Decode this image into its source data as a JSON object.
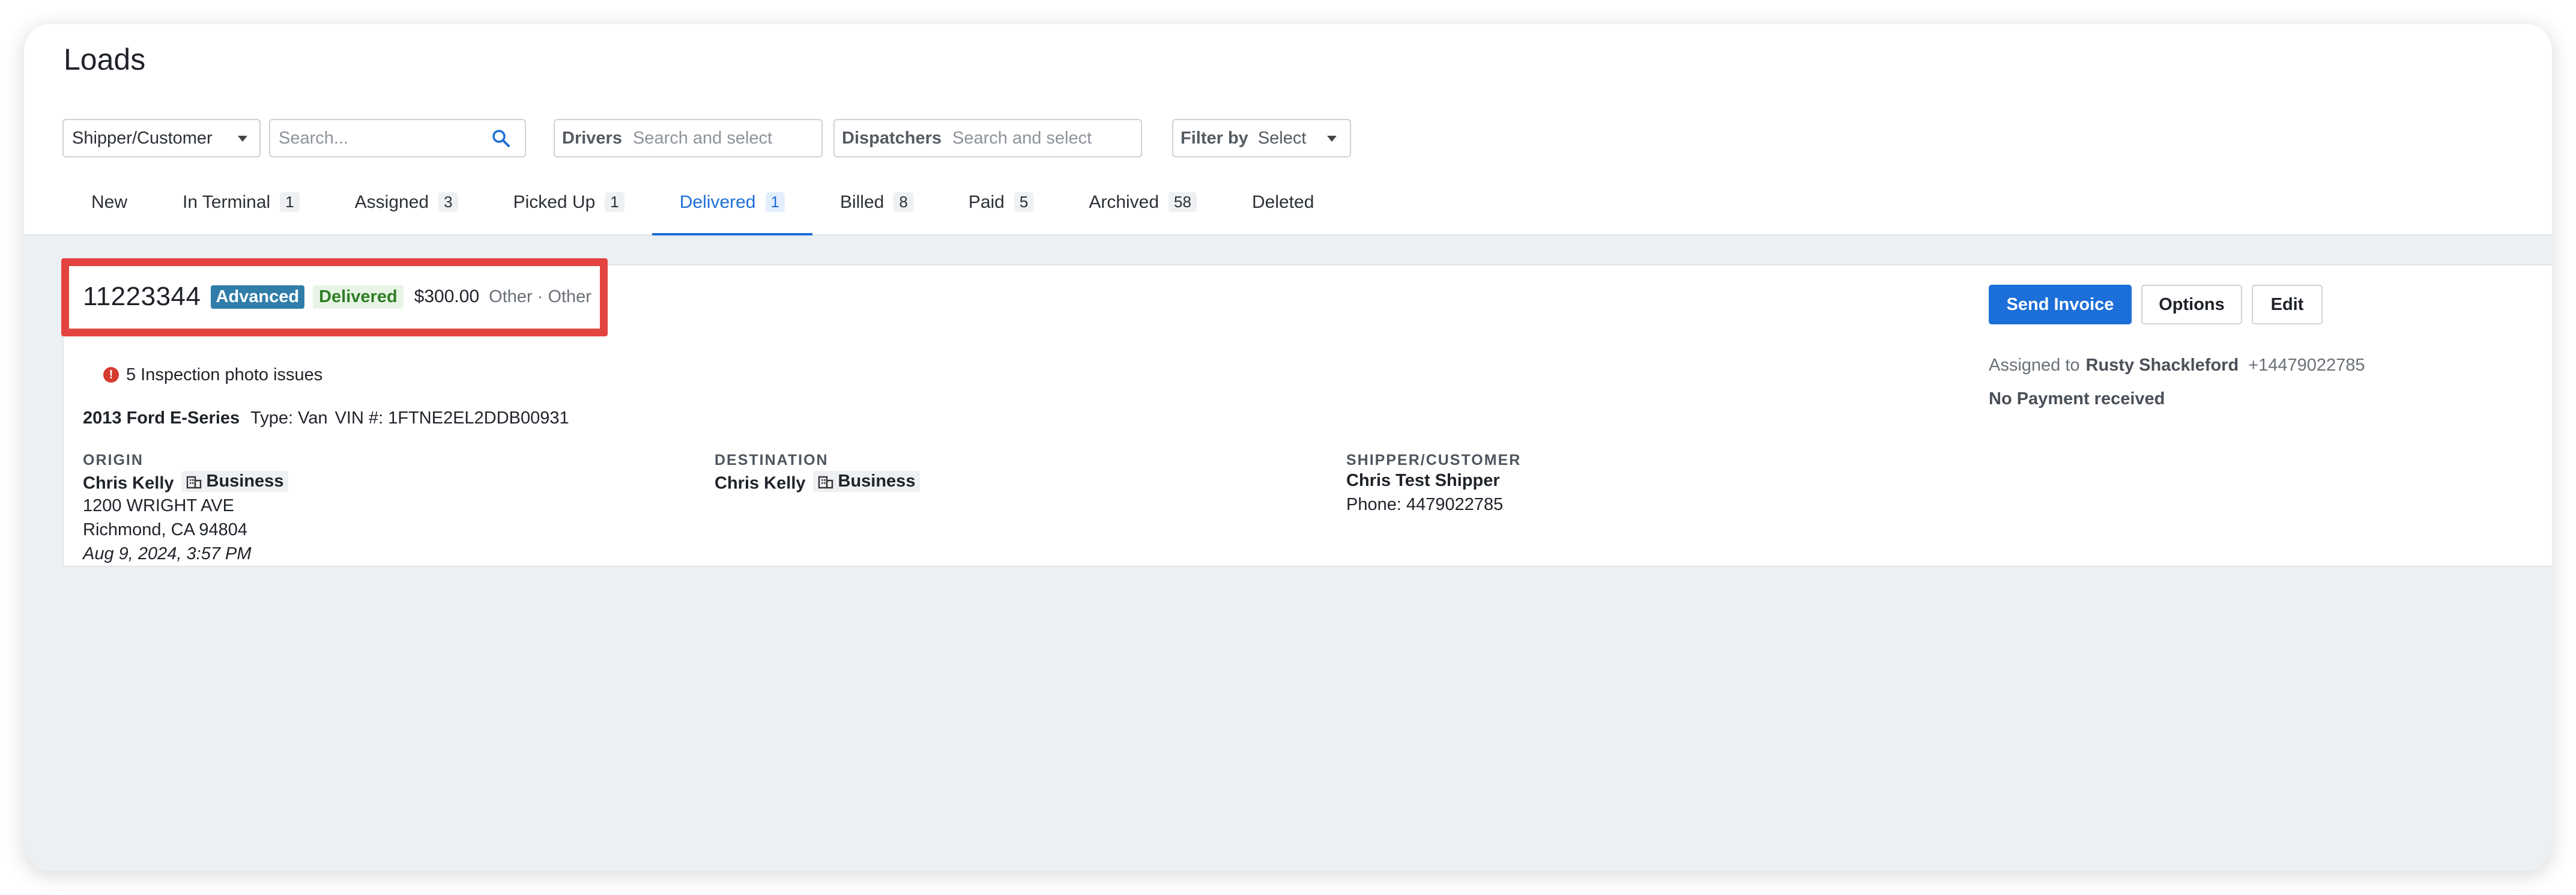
{
  "page": {
    "title": "Loads"
  },
  "filters": {
    "shipper_select": "Shipper/Customer",
    "search_placeholder": "Search...",
    "drivers_label": "Drivers",
    "drivers_placeholder": "Search and select",
    "dispatchers_label": "Dispatchers",
    "dispatchers_placeholder": "Search and select",
    "filter_by_label": "Filter by",
    "filter_by_value": "Select"
  },
  "tabs": [
    {
      "label": "New",
      "count": ""
    },
    {
      "label": "In Terminal",
      "count": "1"
    },
    {
      "label": "Assigned",
      "count": "3"
    },
    {
      "label": "Picked Up",
      "count": "1"
    },
    {
      "label": "Delivered",
      "count": "1"
    },
    {
      "label": "Billed",
      "count": "8"
    },
    {
      "label": "Paid",
      "count": "5"
    },
    {
      "label": "Archived",
      "count": "58"
    },
    {
      "label": "Deleted",
      "count": ""
    }
  ],
  "active_tab": "Delivered",
  "load": {
    "number": "11223344",
    "badge_advanced": "Advanced",
    "badge_status": "Delivered",
    "price": "$300.00",
    "payment_type": "Other · Other",
    "inspection_issues": "5 Inspection photo issues",
    "vehicle": {
      "name": "2013 Ford E-Series",
      "type": "Type: Van",
      "vin": "VIN #: 1FTNE2EL2DDB00931"
    },
    "origin": {
      "label": "ORIGIN",
      "name": "Chris Kelly",
      "tag": "Business",
      "address1": "1200 WRIGHT AVE",
      "address2": "Richmond, CA 94804",
      "date": "Aug 9, 2024, 3:57 PM"
    },
    "destination": {
      "label": "DESTINATION",
      "name": "Chris Kelly",
      "tag": "Business"
    },
    "shipper": {
      "label": "SHIPPER/CUSTOMER",
      "name": "Chris Test Shipper",
      "phone": "Phone: 4479022785"
    },
    "actions": {
      "send_invoice": "Send Invoice",
      "options": "Options",
      "edit": "Edit"
    },
    "assigned_prefix": "Assigned to",
    "assigned_name": "Rusty Shackleford",
    "assigned_phone": "+14479022785",
    "payment_status": "No Payment received"
  },
  "colors": {
    "accent": "#1c6fd8",
    "highlight": "#e3443f",
    "advanced_badge": "#2f7da8",
    "delivered_badge_text": "#2e7d25",
    "error_icon": "#d63a2f"
  }
}
